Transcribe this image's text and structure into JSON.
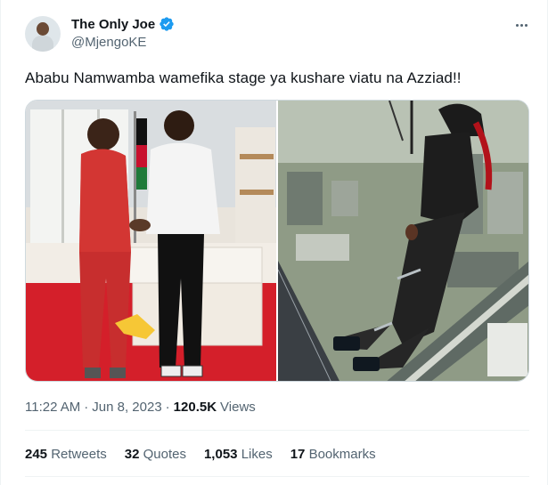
{
  "author": {
    "display_name": "The Only Joe",
    "handle": "@MjengoKE",
    "verified_color": "#1d9bf0"
  },
  "tweet": {
    "text": "Ababu Namwamba wamefika stage ya kushare viatu na Azziad!!"
  },
  "meta": {
    "time": "11:22 AM",
    "separator1": "·",
    "date": "Jun 8, 2023",
    "separator2": "·",
    "views_count": "120.5K",
    "views_label": "Views"
  },
  "stats": [
    {
      "count": "245",
      "label": "Retweets"
    },
    {
      "count": "32",
      "label": "Quotes"
    },
    {
      "count": "1,053",
      "label": "Likes"
    },
    {
      "count": "17",
      "label": "Bookmarks"
    }
  ],
  "icons": {
    "more": "more-icon",
    "verified": "verified-badge-icon"
  }
}
